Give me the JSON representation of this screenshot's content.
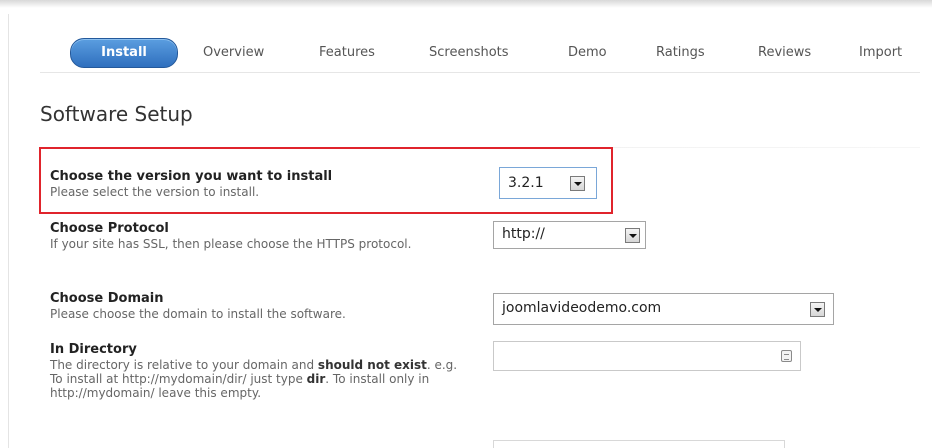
{
  "tabs": {
    "install": "Install",
    "overview": "Overview",
    "features": "Features",
    "screenshots": "Screenshots",
    "demo": "Demo",
    "ratings": "Ratings",
    "reviews": "Reviews",
    "import": "Import"
  },
  "page_title": "Software Setup",
  "fields": {
    "version": {
      "label": "Choose the version you want to install",
      "description": "Please select the version to install.",
      "value": "3.2.1"
    },
    "protocol": {
      "label": "Choose Protocol",
      "description": "If your site has SSL, then please choose the HTTPS protocol.",
      "value": "http://"
    },
    "domain": {
      "label": "Choose Domain",
      "description": "Please choose the domain to install the software.",
      "value": "joomlavideodemo.com"
    },
    "directory": {
      "label": "In Directory",
      "desc_1": "The directory is relative to your domain and ",
      "desc_2": "should not exist",
      "desc_3": ". e.g. To install at http://mydomain/dir/ just type ",
      "desc_4": "dir",
      "desc_5": ". To install only in http://mydomain/ leave this empty.",
      "value": ""
    }
  },
  "colors": {
    "install_tab": "#3a7fcf",
    "highlight_border": "#e0242c"
  }
}
